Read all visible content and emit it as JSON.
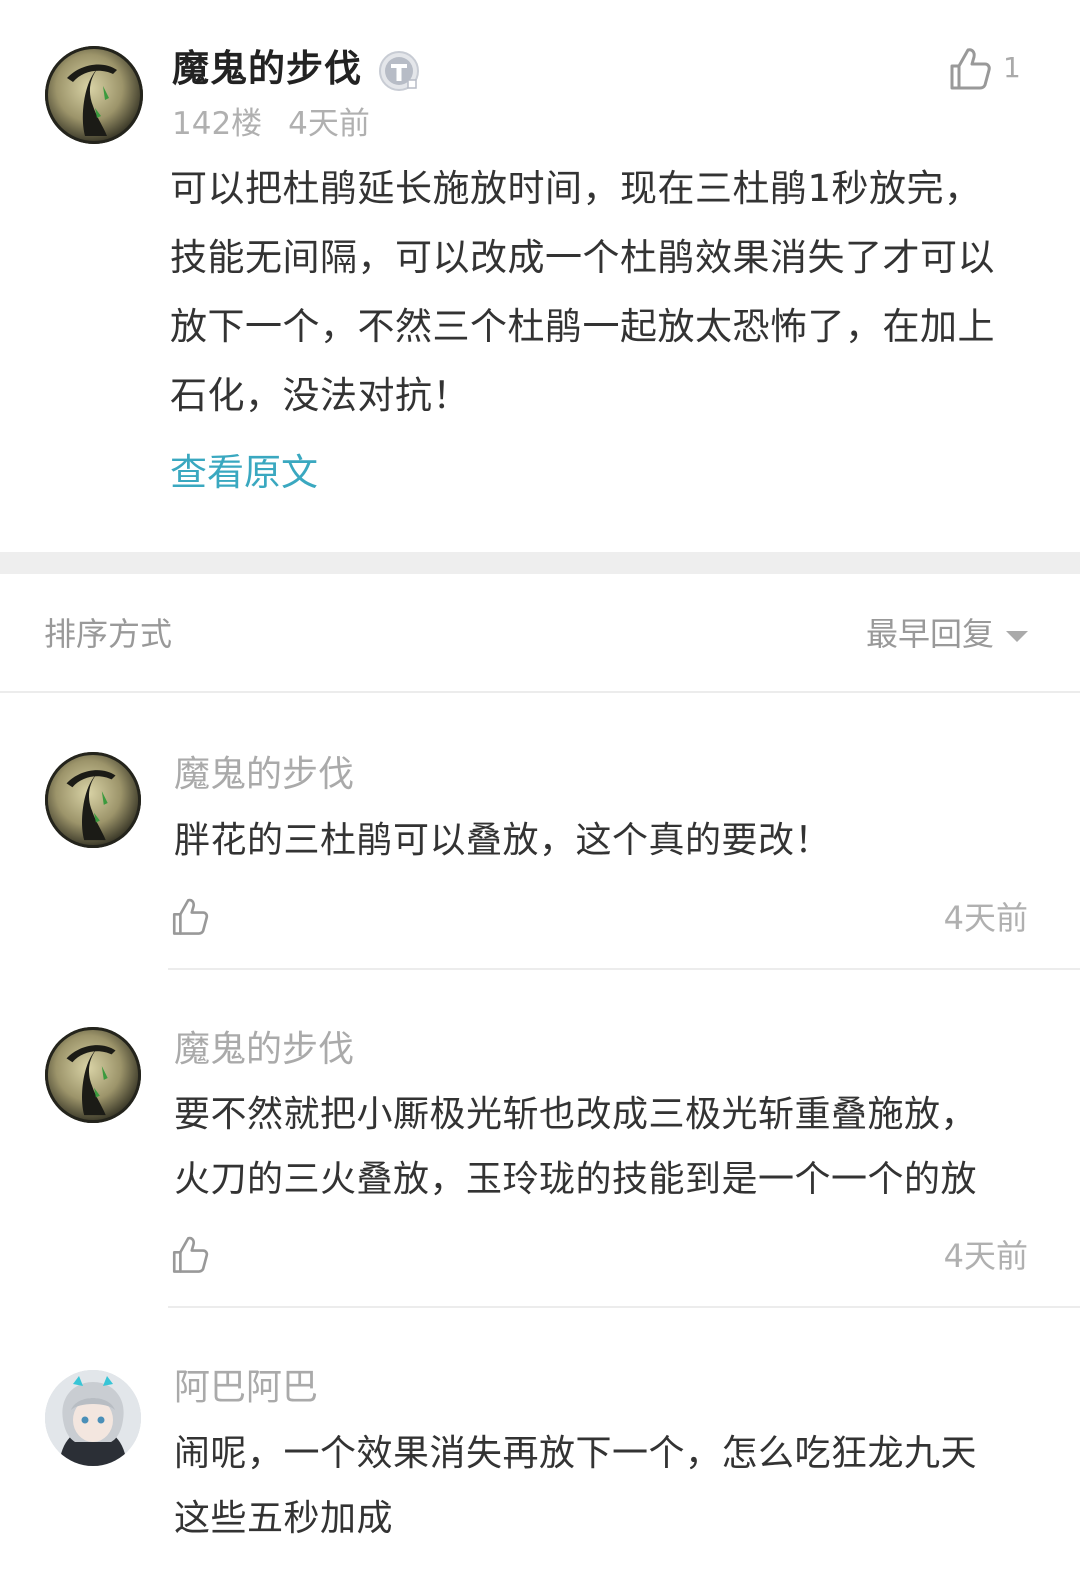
{
  "main_post": {
    "user_name": "魔鬼的步伐",
    "badge_icon": "tieba-t-badge-icon",
    "like_count": "1",
    "floor": "142楼",
    "time": "4天前",
    "body_lines": [
      "可以把杜鹃延长施放时间，现在三杜鹃1秒放完，",
      "技能无间隔，可以改成一个杜鹃效果消失了才可以",
      "放下一个，不然三个杜鹃一起放太恐怖了，在加上",
      "石化，没法对抗！"
    ],
    "view_original": "查看原文"
  },
  "sort": {
    "label": "排序方式",
    "selected": "最早回复"
  },
  "replies": [
    {
      "user_name": "魔鬼的步伐",
      "lines": [
        "胖花的三杜鹃可以叠放，这个真的要改！"
      ],
      "time": "4天前"
    },
    {
      "user_name": "魔鬼的步伐",
      "lines": [
        "要不然就把小厮极光斩也改成三极光斩重叠施放，",
        "火刀的三火叠放，玉玲珑的技能到是一个一个的放"
      ],
      "time": "4天前"
    },
    {
      "user_name": "阿巴阿巴",
      "lines": [
        "闹呢，一个效果消失再放下一个，怎么吃狂龙九天",
        "这些五秒加成"
      ]
    }
  ],
  "colors": {
    "link": "#3aa8c0",
    "muted": "#b0b0b0",
    "separator": "#eeeeee"
  }
}
